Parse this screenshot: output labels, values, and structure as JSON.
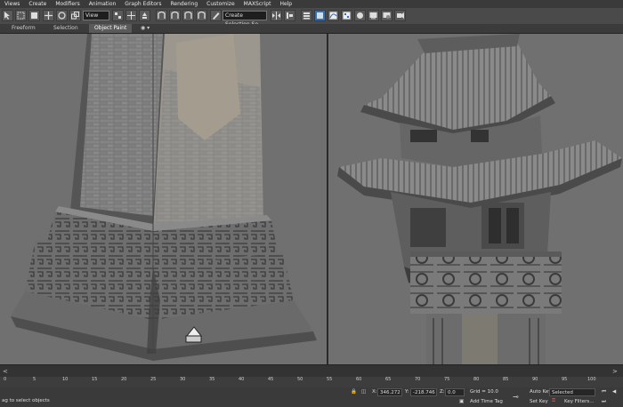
{
  "menu": [
    "Views",
    "Create",
    "Modifiers",
    "Animation",
    "Graph Editors",
    "Rendering",
    "Customize",
    "MAXScript",
    "Help"
  ],
  "toolbar": {
    "selection_set_dropdown": "View",
    "named_selection_dropdown": "Create Selection Se"
  },
  "ribbon": {
    "tabs": [
      "Freeform",
      "Selection",
      "Object Paint"
    ],
    "active_tab": "Object Paint"
  },
  "timeline": {
    "ticks": [
      "0",
      "5",
      "10",
      "15",
      "20",
      "25",
      "30",
      "35",
      "40",
      "45",
      "50",
      "55",
      "60",
      "65",
      "70",
      "75",
      "80",
      "85",
      "90",
      "95",
      "100"
    ]
  },
  "status": {
    "prompt": "ag to select objects",
    "x_label": "X:",
    "x_value": "346.272",
    "y_label": "Y:",
    "y_value": "-218.746",
    "z_label": "Z:",
    "z_value": "0.0",
    "grid": "Grid = 10.0",
    "add_time_tag": "Add Time Tag",
    "auto_key": "Auto Key",
    "auto_key_dropdown": "Selected",
    "set_key": "Set Key",
    "key_filters": "Key Filters..."
  }
}
